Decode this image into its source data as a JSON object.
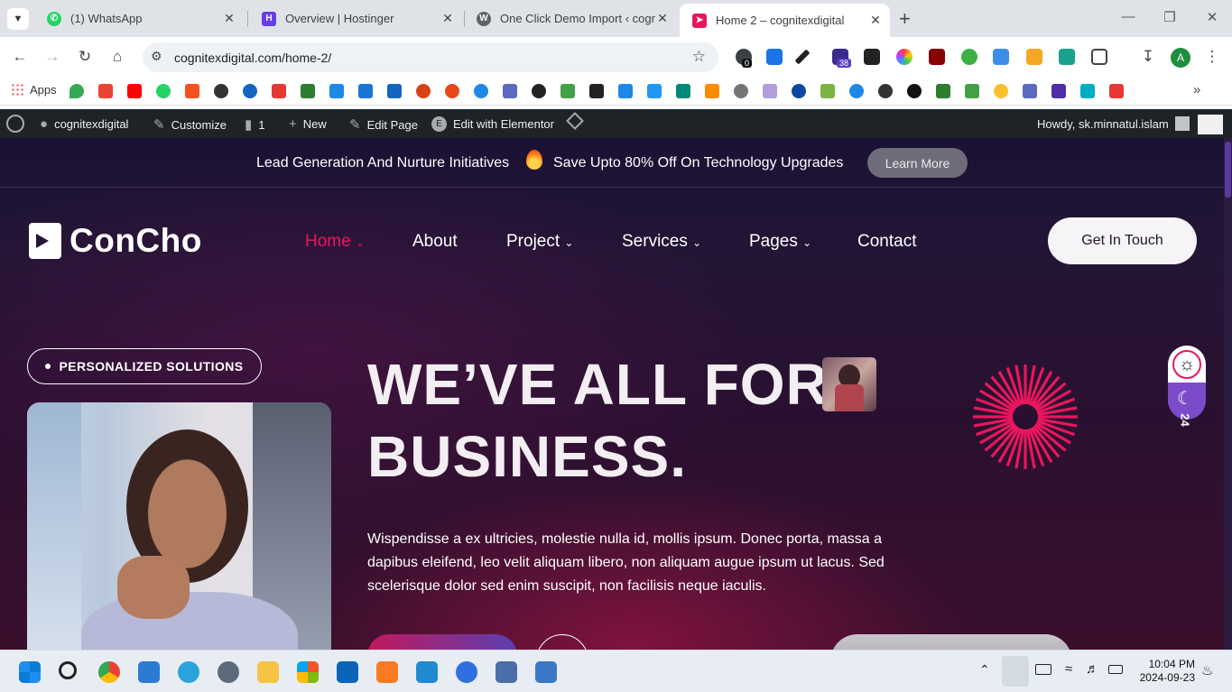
{
  "browser": {
    "tabs": [
      {
        "title": "(1) WhatsApp",
        "color": "#25d366"
      },
      {
        "title": "Overview | Hostinger",
        "color": "#673de6"
      },
      {
        "title": "One Click Demo Import ‹ cognit",
        "color": "#5f6368"
      },
      {
        "title": "Home 2 – cognitexdigital",
        "color": "#e8175d"
      }
    ],
    "active_tab": 3,
    "url": "cognitexdigital.com/home-2/",
    "bookmarks_label": "Apps",
    "ext_badge_1": "0",
    "ext_badge_2": "38"
  },
  "wp_admin": {
    "site_name": "cognitexdigital",
    "customize": "Customize",
    "comments": "1",
    "new": "New",
    "edit_page": "Edit Page",
    "edit_elementor": "Edit with Elementor",
    "howdy": "Howdy, sk.minnatul.islam"
  },
  "site": {
    "promo_left": "Lead Generation And Nurture Initiatives",
    "promo_right": "Save Upto 80% Off On Technology Upgrades",
    "learn_more": "Learn More",
    "logo": "ConCho",
    "nav": {
      "home": "Home",
      "about": "About",
      "project": "Project",
      "services": "Services",
      "pages": "Pages",
      "contact": "Contact"
    },
    "cta": "Get In Touch",
    "badge": "PERSONALIZED SOLUTIONS",
    "headline_1": "WE’VE ALL FOR",
    "headline_2": "BUSINESS.",
    "paragraph": "Wispendisse a ex ultricies, molestie nulla id, mollis ipsum. Donec porta, massa a dapibus eleifend, leo velit aliquam libero, non aliquam augue ipsum ut lacus. Sed scelerisque dolor sed enim suscipit, non facilisis neque iaculis.",
    "side_number": "24",
    "accent_color": "#e8175d"
  },
  "taskbar": {
    "time": "10:04 PM",
    "date": "2024-09-23"
  }
}
